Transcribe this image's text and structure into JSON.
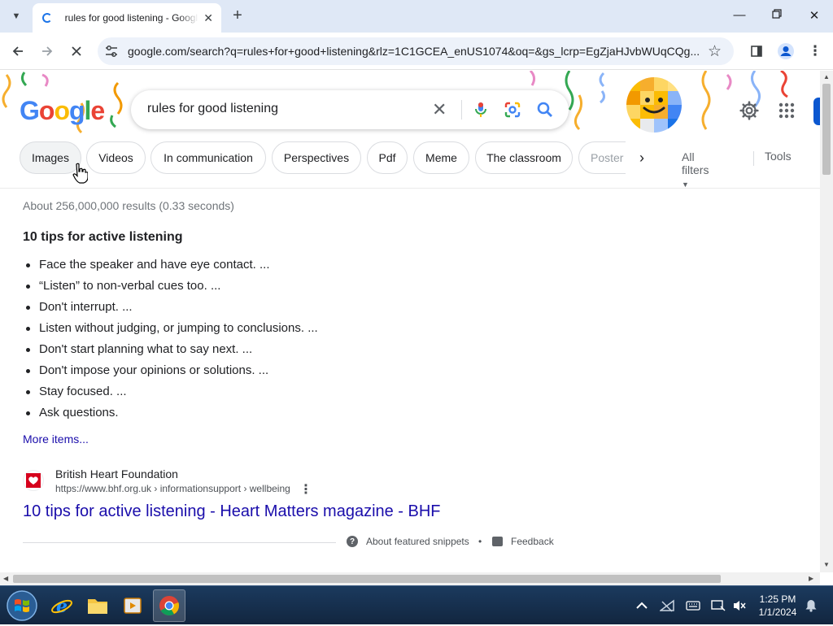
{
  "browser": {
    "tab_title": "rules for good listening - Google Search",
    "url": "google.com/search?q=rules+for+good+listening&rlz=1C1GCEA_enUS1074&oq=&gs_lcrp=EgZjaHJvbWUqCQg..."
  },
  "search": {
    "logo_letters": [
      "G",
      "o",
      "o",
      "g",
      "l",
      "e"
    ],
    "logo_colors": [
      "#4285f4",
      "#ea4335",
      "#fbbc05",
      "#4285f4",
      "#34a853",
      "#ea4335"
    ],
    "query": "rules for good listening"
  },
  "chips": [
    "Images",
    "Videos",
    "In communication",
    "Perspectives",
    "Pdf",
    "Meme",
    "The classroom",
    "Poster"
  ],
  "filters": {
    "all_filters": "All filters",
    "tools": "Tools"
  },
  "results": {
    "stats": "About 256,000,000 results (0.33 seconds)",
    "snippet_title": "10 tips for active listening",
    "items": [
      "Face the speaker and have eye contact. ...",
      "“Listen” to non-verbal cues too. ...",
      "Don't interrupt. ...",
      "Listen without judging, or jumping to conclusions. ...",
      "Don't start planning what to say next. ...",
      "Don't impose your opinions or solutions. ...",
      "Stay focused. ...",
      "Ask questions."
    ],
    "more": "More items...",
    "source": {
      "site": "British Heart Foundation",
      "cite": "https://www.bhf.org.uk › informationsupport › wellbeing",
      "title": "10 tips for active listening - Heart Matters magazine - BHF"
    },
    "about_snippets": "About featured snippets",
    "dot": "•",
    "feedback": "Feedback"
  },
  "taskbar": {
    "time": "1:25 PM",
    "date": "1/1/2024"
  },
  "colors": {
    "link": "#1a0dab",
    "accent": "#1a73e8",
    "signin": "#0b57d0",
    "bhf_red": "#d6001c"
  }
}
